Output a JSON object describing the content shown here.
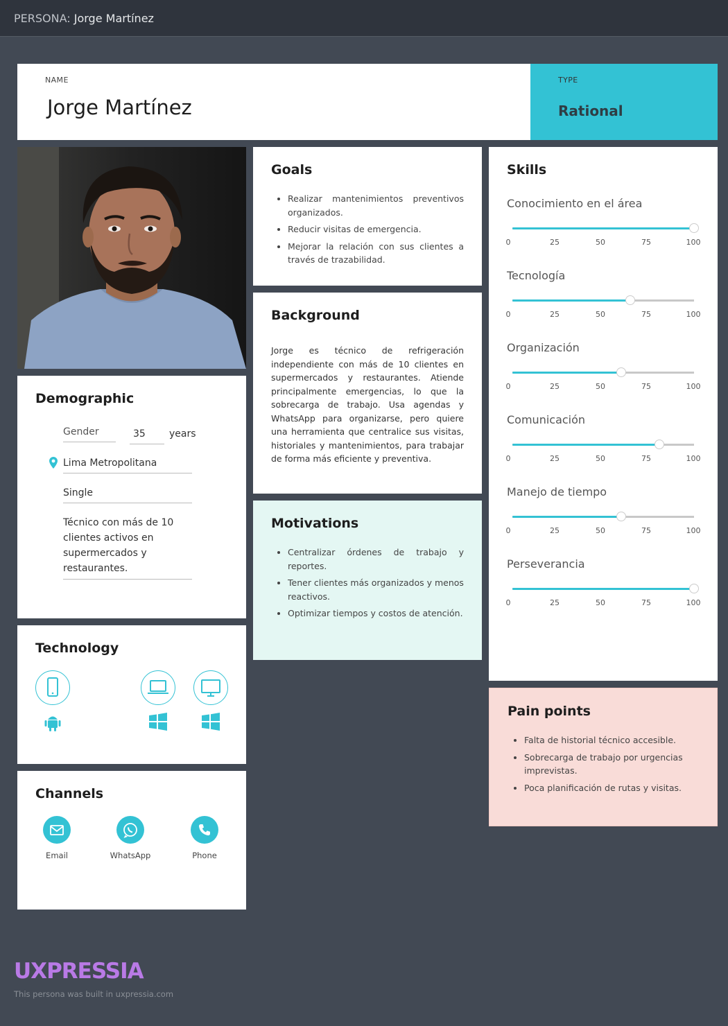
{
  "header": {
    "prefix": "PERSONA:",
    "name": "Jorge Martínez"
  },
  "name_card": {
    "label": "NAME",
    "value": "Jorge Martínez"
  },
  "type_card": {
    "label": "TYPE",
    "value": "Rational"
  },
  "goals": {
    "title": "Goals",
    "items": [
      "Realizar mantenimientos preventivos organizados.",
      "Reducir visitas de emergencia.",
      "Mejorar la relación con sus clientes a través de trazabilidad."
    ]
  },
  "background": {
    "title": "Background",
    "text": "Jorge es técnico de refrigeración independiente con más de 10 clientes en supermercados y restaurantes. Atiende principalmente emergencias, lo que la sobrecarga de trabajo. Usa agendas y WhatsApp para organizarse, pero quiere una herramienta que centralice sus visitas, historiales y mantenimientos, para trabajar de forma más eficiente y preventiva."
  },
  "motivations": {
    "title": "Motivations",
    "items": [
      "Centralizar órdenes de trabajo y reportes.",
      "Tener clientes más organizados y menos reactivos.",
      "Optimizar tiempos y costos de atención."
    ]
  },
  "demographic": {
    "title": "Demographic",
    "gender": "Gender",
    "age": "35",
    "age_unit": "years",
    "location": "Lima Metropolitana",
    "status": "Single",
    "occupation": "Técnico con más de 10 clientes activos en supermercados y restaurantes."
  },
  "skills": {
    "title": "Skills",
    "ticks": [
      "0",
      "25",
      "50",
      "75",
      "100"
    ],
    "items": [
      {
        "name": "Conocimiento en el área",
        "value": 100
      },
      {
        "name": "Tecnología",
        "value": 65
      },
      {
        "name": "Organización",
        "value": 60
      },
      {
        "name": "Comunicación",
        "value": 81
      },
      {
        "name": "Manejo de tiempo",
        "value": 60
      },
      {
        "name": "Perseverancia",
        "value": 100
      }
    ]
  },
  "pain_points": {
    "title": "Pain points",
    "items": [
      "Falta de historial técnico accesible.",
      "Sobrecarga de trabajo por urgencias imprevistas.",
      "Poca planificación de rutas y visitas."
    ]
  },
  "technology": {
    "title": "Technology",
    "devices": [
      "mobile-icon",
      "laptop-icon",
      "desktop-icon"
    ],
    "os": [
      "android-icon",
      "windows-icon",
      "windows-icon"
    ]
  },
  "channels": {
    "title": "Channels",
    "items": [
      {
        "label": "Email",
        "icon": "email-icon"
      },
      {
        "label": "WhatsApp",
        "icon": "whatsapp-icon"
      },
      {
        "label": "Phone",
        "icon": "phone-icon"
      }
    ]
  },
  "footer": {
    "brand": "UXPRESSIA",
    "note": "This persona was built in uxpressia.com"
  },
  "colors": {
    "accent": "#33c2d4",
    "background": "#424954",
    "topbar": "#2f343d",
    "motivations_bg": "#e4f7f3",
    "pain_bg": "#f9dcd8",
    "brand": "#b97ae6"
  }
}
